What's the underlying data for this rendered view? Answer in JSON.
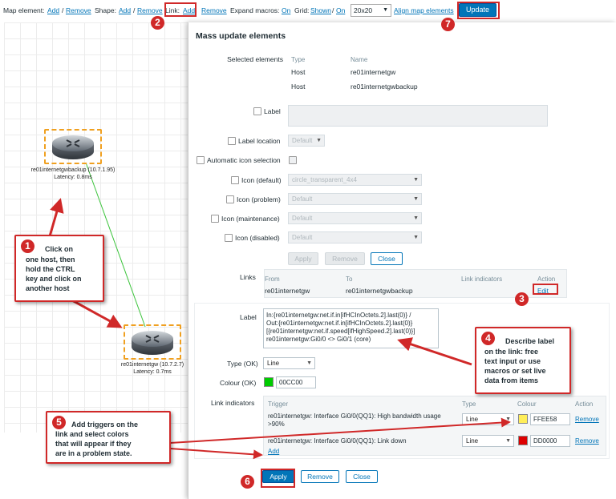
{
  "toolbar": {
    "map_element_label": "Map element:",
    "add": "Add",
    "slash": "/",
    "remove": "Remove",
    "shape_label": "Shape:",
    "link_label": "Link:",
    "expand_macros_label": "Expand macros:",
    "expand_macros_value": "On",
    "grid_label": "Grid:",
    "grid_shown": "Shown",
    "grid_on": "On",
    "grid_size": "20x20",
    "align": "Align map elements",
    "update": "Update"
  },
  "map": {
    "host_backup": {
      "name": "re01internetgwbackup (10.7.1.95)",
      "latency": "Latency: 0.8ms"
    },
    "host_main": {
      "name": "re01internetgw (10.7.2.7)",
      "latency": "Latency: 0.7ms"
    },
    "link_color": "#3cc43c"
  },
  "dialog": {
    "title": "Mass update elements",
    "selected_label": "Selected elements",
    "col_type": "Type",
    "col_name": "Name",
    "selected": [
      {
        "type": "Host",
        "name": "re01internetgw"
      },
      {
        "type": "Host",
        "name": "re01internetgwbackup"
      }
    ],
    "label_label": "Label",
    "label_location_label": "Label location",
    "label_location_value": "Default",
    "auto_icon_label": "Automatic icon selection",
    "icon_default_label": "Icon (default)",
    "icon_default_value": "circle_transparent_4x4",
    "icon_problem_label": "Icon (problem)",
    "icon_problem_value": "Default",
    "icon_maint_label": "Icon (maintenance)",
    "icon_maint_value": "Default",
    "icon_disabled_label": "Icon (disabled)",
    "icon_disabled_value": "Default",
    "apply": "Apply",
    "remove": "Remove",
    "close": "Close"
  },
  "links": {
    "label": "Links",
    "col_from": "From",
    "col_to": "To",
    "col_indicators": "Link indicators",
    "col_action": "Action",
    "from": "re01internetgw",
    "to": "re01internetgwbackup",
    "edit": "Edit"
  },
  "link_form": {
    "label_label": "Label",
    "label_lines": [
      "In:{re01internetgw:net.if.in[ifHCInOctets.2].last(0)} /",
      "Out:{re01internetgw:net.if.in[ifHCInOctets.2].last(0)}",
      "[{re01internetgw:net.if.speed[ifHighSpeed.2].last(0)}]",
      "re01internetgw:Gi0/0 <> Gi0/1 (core)"
    ],
    "type_label": "Type (OK)",
    "type_value": "Line",
    "colour_label": "Colour (OK)",
    "colour_value": "00CC00",
    "colour_hex": "#00cc00",
    "indicators_label": "Link indicators",
    "col_trigger": "Trigger",
    "col_type": "Type",
    "col_colour": "Colour",
    "col_action": "Action",
    "triggers": [
      {
        "line1": "re01internetgw: Interface Gi0/0(QQ1): High bandwidth usage",
        "line2": ">90%",
        "type": "Line",
        "colour": "FFEE58",
        "hex": "#ffee58",
        "action": "Remove"
      },
      {
        "line1": "re01internetgw: Interface Gi0/0(QQ1): Link down",
        "line2": "",
        "type": "Line",
        "colour": "DD0000",
        "hex": "#dd0000",
        "action": "Remove"
      }
    ],
    "add": "Add",
    "apply": "Apply",
    "remove": "Remove",
    "close": "Close"
  },
  "annotations": {
    "n1": "1",
    "n2": "2",
    "n3": "3",
    "n4": "4",
    "n5": "5",
    "n6": "6",
    "n7": "7",
    "c1": [
      "Click on",
      "one host, then",
      "hold the CTRL",
      "key and click on",
      "another host"
    ],
    "c4": [
      "Describe label",
      "on the link: free",
      "text input or use",
      "macros or set live",
      "data from items"
    ],
    "c5": [
      "Add triggers on the",
      "link and select colors",
      "that will appear if they",
      "are in a problem state."
    ],
    "accent": "#d02828"
  }
}
